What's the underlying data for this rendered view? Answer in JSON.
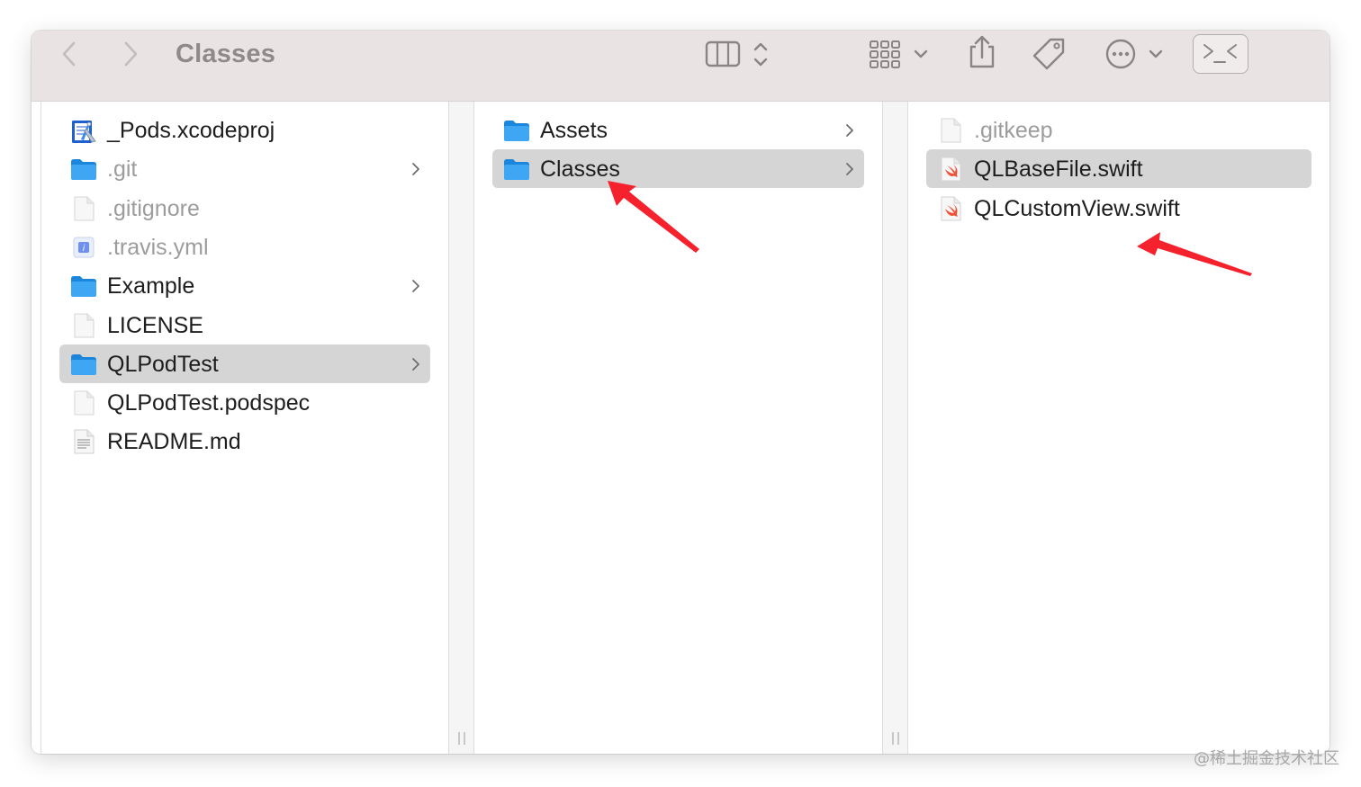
{
  "window": {
    "title": "Classes"
  },
  "colors": {
    "accent_arrow": "#f5222d",
    "folder": "#2d9cf0",
    "selected_row": "#d6d5d6",
    "toolbar_bg": "#eae3e3"
  },
  "columns": [
    {
      "items": [
        {
          "label": "_Pods.xcodeproj",
          "icon": "xcodeproj-icon",
          "dim": false,
          "chevron": false,
          "selected": false
        },
        {
          "label": ".git",
          "icon": "folder-icon",
          "dim": true,
          "chevron": true,
          "selected": false
        },
        {
          "label": ".gitignore",
          "icon": "file-icon",
          "dim": true,
          "chevron": false,
          "selected": false
        },
        {
          "label": ".travis.yml",
          "icon": "yml-icon",
          "dim": true,
          "chevron": false,
          "selected": false
        },
        {
          "label": "Example",
          "icon": "folder-icon",
          "dim": false,
          "chevron": true,
          "selected": false
        },
        {
          "label": "LICENSE",
          "icon": "file-icon",
          "dim": false,
          "chevron": false,
          "selected": false
        },
        {
          "label": "QLPodTest",
          "icon": "folder-icon",
          "dim": false,
          "chevron": true,
          "selected": true
        },
        {
          "label": "QLPodTest.podspec",
          "icon": "file-icon",
          "dim": false,
          "chevron": false,
          "selected": false
        },
        {
          "label": "README.md",
          "icon": "text-file-icon",
          "dim": false,
          "chevron": false,
          "selected": false
        }
      ]
    },
    {
      "items": [
        {
          "label": "Assets",
          "icon": "folder-icon",
          "dim": false,
          "chevron": true,
          "selected": false
        },
        {
          "label": "Classes",
          "icon": "folder-icon",
          "dim": false,
          "chevron": true,
          "selected": true
        }
      ]
    },
    {
      "items": [
        {
          "label": ".gitkeep",
          "icon": "file-icon",
          "dim": true,
          "chevron": false,
          "selected": false
        },
        {
          "label": "QLBaseFile.swift",
          "icon": "swift-file-icon",
          "dim": false,
          "chevron": false,
          "selected": true
        },
        {
          "label": "QLCustomView.swift",
          "icon": "swift-file-icon",
          "dim": false,
          "chevron": false,
          "selected": false
        }
      ]
    }
  ],
  "watermark": "@稀土掘金技术社区"
}
